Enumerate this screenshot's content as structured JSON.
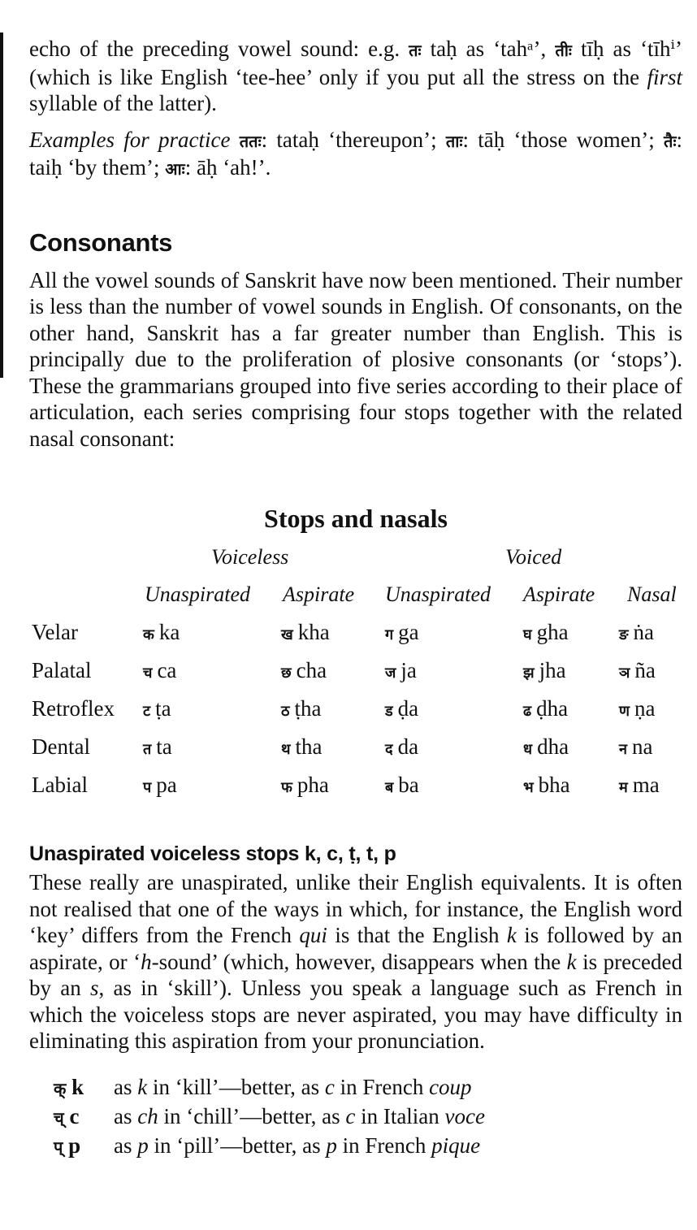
{
  "intro": {
    "text1a": "echo of the preceding vowel sound: e.g. ",
    "deva1": "तः",
    "text1b": " taḥ as ‘tahᵃ’, ",
    "deva2": "तीः",
    "text1c": " tīḥ as ‘tīhⁱ’ (which is like English ‘tee-hee’ only if you put all the stress on the ",
    "first": "first",
    "text1d": " syllable of the latter).",
    "ex_label": "Examples for practice",
    "ex_deva1": "ततः",
    "ex_t1": ": tataḥ ‘thereupon’; ",
    "ex_deva2": "ताः",
    "ex_t2": ": tāḥ ‘those women’; ",
    "ex_deva3": "तैः",
    "ex_t3": ": taiḥ ‘by them’; ",
    "ex_deva4": "आः",
    "ex_t4": ": āḥ ‘ah!’."
  },
  "consonants": {
    "heading": "Consonants",
    "body": "All the vowel sounds of Sanskrit have now been mentioned. Their number is less than the number of vowel sounds in English. Of consonants, on the other hand, Sanskrit has a far greater number than English. This is principally due to the proliferation of plosive consonants (or ‘stops’). These the grammarians grouped into five series according to their place of articulation, each series comprising four stops together with the related nasal consonant:"
  },
  "table": {
    "title": "Stops and nasals",
    "group_voiceless": "Voiceless",
    "group_voiced": "Voiced",
    "columns": [
      "Unaspirated",
      "Aspirate",
      "Unaspirated",
      "Aspirate",
      "Nasal"
    ],
    "rows": [
      {
        "label": "Velar",
        "cells": [
          [
            "क",
            "ka"
          ],
          [
            "ख",
            "kha"
          ],
          [
            "ग",
            "ga"
          ],
          [
            "घ",
            "gha"
          ],
          [
            "ङ",
            "ṅa"
          ]
        ]
      },
      {
        "label": "Palatal",
        "cells": [
          [
            "च",
            "ca"
          ],
          [
            "छ",
            "cha"
          ],
          [
            "ज",
            "ja"
          ],
          [
            "झ",
            "jha"
          ],
          [
            "ञ",
            "ña"
          ]
        ]
      },
      {
        "label": "Retroflex",
        "cells": [
          [
            "ट",
            "ṭa"
          ],
          [
            "ठ",
            "ṭha"
          ],
          [
            "ड",
            "ḍa"
          ],
          [
            "ढ",
            "ḍha"
          ],
          [
            "ण",
            "ṇa"
          ]
        ]
      },
      {
        "label": "Dental",
        "cells": [
          [
            "त",
            "ta"
          ],
          [
            "थ",
            "tha"
          ],
          [
            "द",
            "da"
          ],
          [
            "ध",
            "dha"
          ],
          [
            "न",
            "na"
          ]
        ]
      },
      {
        "label": "Labial",
        "cells": [
          [
            "प",
            "pa"
          ],
          [
            "फ",
            "pha"
          ],
          [
            "ब",
            "ba"
          ],
          [
            "भ",
            "bha"
          ],
          [
            "म",
            "ma"
          ]
        ]
      }
    ]
  },
  "stops": {
    "heading": "Unaspirated voiceless stops k, c, ṭ, t, p",
    "body_a": "These really are unaspirated, unlike their English equivalents. It is often not realised that one of the ways in which, for instance, the English word ‘key’ differs from the French ",
    "qui": "qui",
    "body_b": " is that the English ",
    "k1": "k",
    "body_c": " is followed by an aspirate, or ‘",
    "h": "h",
    "body_d": "-sound’ (which, however, disappears when the ",
    "k2": "k",
    "body_e": " is preceded by an ",
    "s": "s",
    "body_f": ", as in ‘skill’). Unless you speak a language such as French in which the voiceless stops are never aspirated, you may have difficulty in eliminating this aspiration from your pronunciation.",
    "examples": [
      {
        "deva": "क्",
        "roman": "k",
        "pre": "as ",
        "it1": "k",
        "mid": " in ‘kill’—better, as ",
        "it2": "c",
        "post": " in French ",
        "it3": "coup"
      },
      {
        "deva": "च्",
        "roman": "c",
        "pre": "as ",
        "it1": "ch",
        "mid": " in ‘chill’—better, as ",
        "it2": "c",
        "post": " in Italian ",
        "it3": "voce"
      },
      {
        "deva": "प्",
        "roman": "p",
        "pre": "as ",
        "it1": "p",
        "mid": " in ‘pill’—better, as ",
        "it2": "p",
        "post": " in French ",
        "it3": "pique"
      }
    ]
  }
}
